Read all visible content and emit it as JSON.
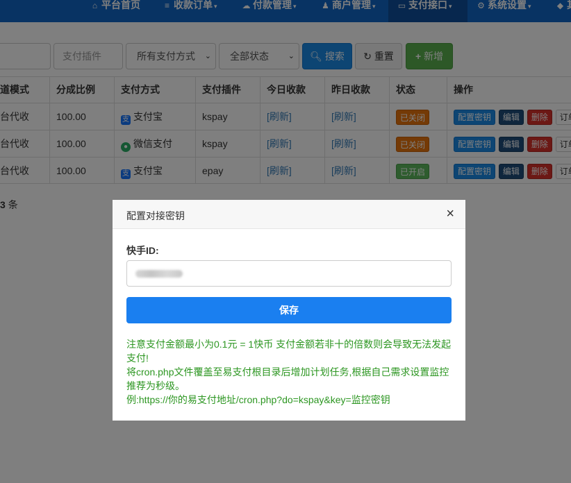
{
  "nav": {
    "items": [
      {
        "icon": "home-icon",
        "glyph": "⌂",
        "label": "平台首页",
        "caret": false
      },
      {
        "icon": "list-icon",
        "glyph": "≡",
        "label": "收款订单",
        "caret": true
      },
      {
        "icon": "cloud-icon",
        "glyph": "☁",
        "label": "付款管理",
        "caret": true
      },
      {
        "icon": "user-icon",
        "glyph": "👤",
        "label": "商户管理",
        "caret": true
      },
      {
        "icon": "card-icon",
        "glyph": "▭",
        "label": "支付接口",
        "caret": true
      },
      {
        "icon": "gear-icon",
        "glyph": "⚙",
        "label": "系统设置",
        "caret": true
      },
      {
        "icon": "cube-icon",
        "glyph": "◆",
        "label": "其",
        "caret": false
      }
    ]
  },
  "filters": {
    "plugin_placeholder": "支付插件",
    "method_select": "所有支付方式",
    "status_select": "全部状态",
    "search_label": "搜索",
    "reset_label": "重置",
    "add_label": "新增"
  },
  "table": {
    "headers": [
      "道模式",
      "分成比例",
      "支付方式",
      "支付插件",
      "今日收款",
      "昨日收款",
      "状态",
      "操作"
    ],
    "rows": [
      {
        "mode": "台代收",
        "ratio": "100.00",
        "method": "支付宝",
        "method_icon": "alipay-icon",
        "plugin": "kspay",
        "today": "[刷新]",
        "yesterday": "[刷新]",
        "status": "已关闭",
        "status_type": "off"
      },
      {
        "mode": "台代收",
        "ratio": "100.00",
        "method": "微信支付",
        "method_icon": "wechat-icon",
        "plugin": "kspay",
        "today": "[刷新]",
        "yesterday": "[刷新]",
        "status": "已关闭",
        "status_type": "off"
      },
      {
        "mode": "台代收",
        "ratio": "100.00",
        "method": "支付宝",
        "method_icon": "alipay-icon",
        "plugin": "epay",
        "today": "[刷新]",
        "yesterday": "[刷新]",
        "status": "已开启",
        "status_type": "on"
      }
    ],
    "actions": {
      "key": "配置密钥",
      "edit": "编辑",
      "delete": "删除",
      "order": "订单"
    }
  },
  "total": {
    "count": "3",
    "unit": "条"
  },
  "modal": {
    "title": "配置对接密钥",
    "close": "×",
    "field_label": "快手ID:",
    "save_label": "保存",
    "notes": [
      "注意支付金额最小为0.1元 = 1快币 支付金额若非十的倍数则会导致无法发起支付!",
      "将cron.php文件覆盖至易支付根目录后增加计划任务,根据自己需求设置监控推荐为秒级。",
      "例:https://你的易支付地址/cron.php?do=kspay&key=监控密钥"
    ]
  },
  "colors": {
    "nav": "#1167c6",
    "primary": "#1a8ae6",
    "success": "#5bb04f",
    "danger": "#d9302b",
    "warning": "#e8740c",
    "note": "#2c9621"
  }
}
